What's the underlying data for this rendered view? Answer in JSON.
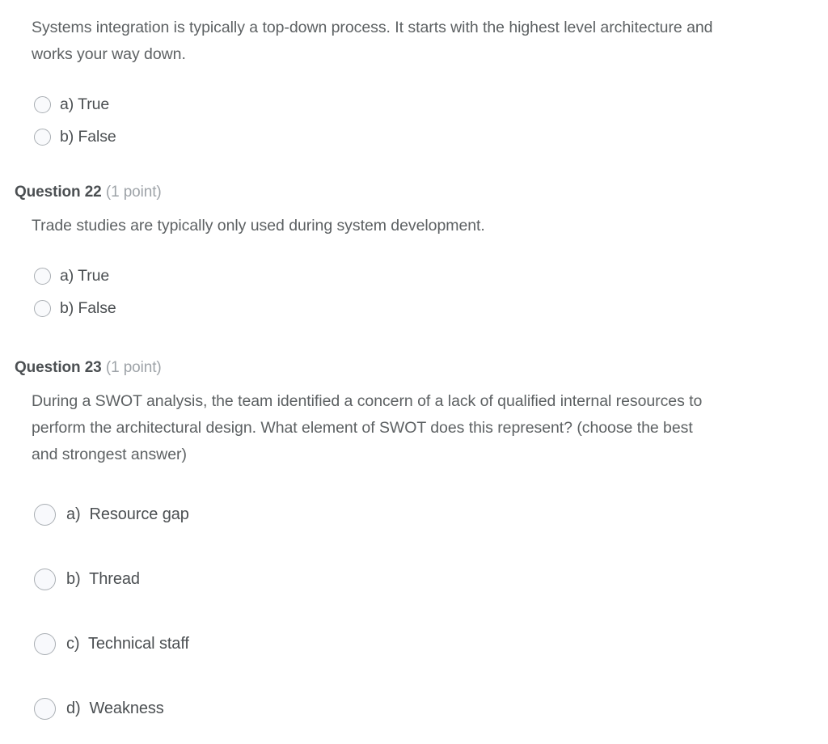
{
  "page": {
    "background_color": "#ffffff",
    "text_color": "#5d6163",
    "heading_color": "#4b4f52",
    "muted_color": "#9ea3a8",
    "radio_border_color": "#a9aeb3",
    "radio_fill_color": "#f8f9fc"
  },
  "questions": [
    {
      "id": "q21-partial",
      "header_visible": false,
      "label": "",
      "points": "",
      "text": "Systems integration is typically a top-down process. It starts with the highest level architecture and works your way down.",
      "style": "compact",
      "options": [
        {
          "prefix": "a)",
          "label": "a) True",
          "selected": false
        },
        {
          "prefix": "b)",
          "label": "b) False",
          "selected": false
        }
      ]
    },
    {
      "id": "q22",
      "header_visible": true,
      "label": "Question 22",
      "points": "(1 point)",
      "text": "Trade studies are typically only used during system development.",
      "style": "compact",
      "options": [
        {
          "prefix": "a)",
          "label": "a) True",
          "selected": false
        },
        {
          "prefix": "b)",
          "label": "b) False",
          "selected": false
        }
      ]
    },
    {
      "id": "q23",
      "header_visible": true,
      "label": "Question 23",
      "points": "(1 point)",
      "text": "During a SWOT analysis, the team identified a concern of a lack of qualified internal resources to perform the architectural design. What element of SWOT does this represent? (choose the best and strongest answer)",
      "style": "spaced",
      "options": [
        {
          "prefix": "a)",
          "label": "a)  Resource gap",
          "selected": false
        },
        {
          "prefix": "b)",
          "label": "b)  Thread",
          "selected": false
        },
        {
          "prefix": "c)",
          "label": "c)  Technical staff",
          "selected": false
        },
        {
          "prefix": "d)",
          "label": "d)  Weakness",
          "selected": false
        }
      ]
    }
  ]
}
